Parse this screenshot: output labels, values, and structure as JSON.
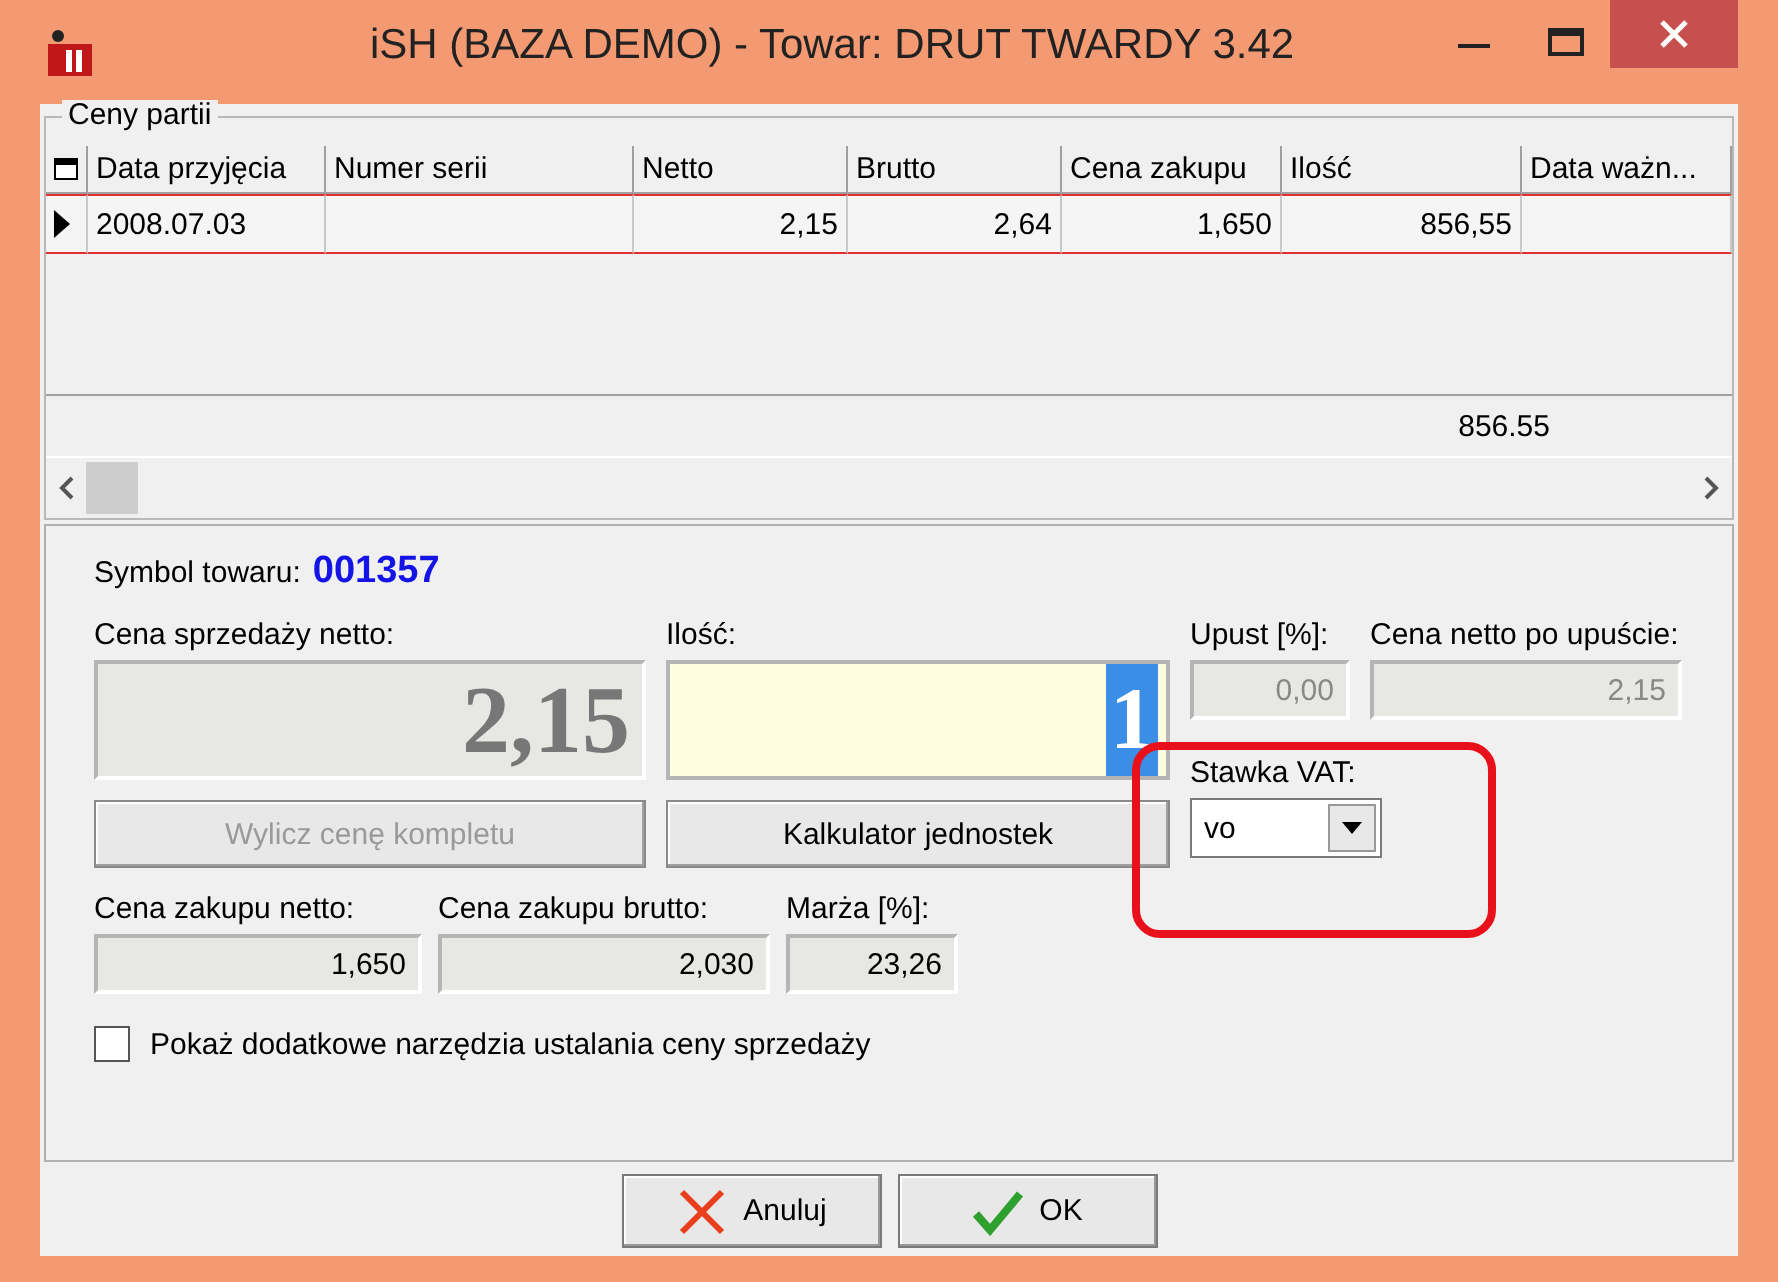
{
  "window": {
    "title": "iSH (BAZA DEMO) - Towar: DRUT TWARDY 3.42"
  },
  "batches": {
    "title": "Ceny partii",
    "columns": [
      "Data przyjęcia",
      "Numer serii",
      "Netto",
      "Brutto",
      "Cena zakupu",
      "Ilość",
      "Data ważn..."
    ],
    "rows": [
      {
        "selected": true,
        "cells": [
          "2008.07.03",
          "",
          "2,15",
          "2,64",
          "1,650",
          "856,55",
          ""
        ]
      }
    ],
    "total": "856.55"
  },
  "symbol": {
    "label": "Symbol towaru:",
    "value": "001357"
  },
  "sale_price": {
    "label": "Cena sprzedaży netto:",
    "value": "2,15"
  },
  "quantity": {
    "label": "Ilość:",
    "value": "1"
  },
  "discount": {
    "label": "Upust [%]:",
    "value": "0,00"
  },
  "net_after": {
    "label": "Cena netto po upuście:",
    "value": "2,15"
  },
  "vat": {
    "label": "Stawka VAT:",
    "value": "vo"
  },
  "buttons": [
    {
      "label": "Wylicz cenę kompletu",
      "disabled": true
    },
    {
      "label": "Kalkulator jednostek",
      "disabled": false
    }
  ],
  "purchase": [
    {
      "label": "Cena zakupu netto:",
      "value": "1,650"
    },
    {
      "label": "Cena zakupu brutto:",
      "value": "2,030"
    },
    {
      "label": "Marża [%]:",
      "value": "23,26"
    }
  ],
  "checkbox": {
    "label": "Pokaż dodatkowe narzędzia ustalania ceny sprzedaży",
    "checked": false
  },
  "dialog_buttons": [
    {
      "kind": "cancel",
      "label": "Anuluj"
    },
    {
      "kind": "ok",
      "label": "OK"
    }
  ]
}
